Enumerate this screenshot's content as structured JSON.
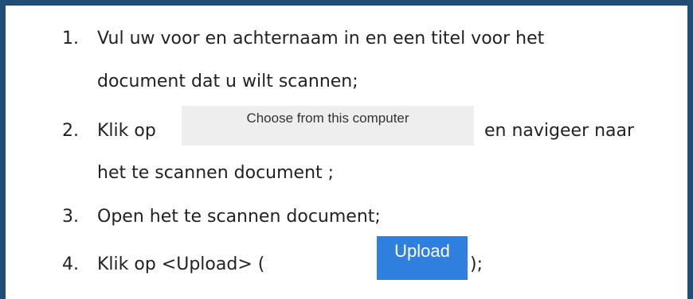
{
  "steps": [
    {
      "number": "1.",
      "line1": "Vul uw voor en achternaam in en een titel voor het",
      "line2": "document dat u wilt scannen;"
    },
    {
      "number": "2.",
      "before": "Klik op",
      "button_label": "Choose from this computer",
      "after": "en navigeer naar",
      "line2": "het te scannen document ;"
    },
    {
      "number": "3.",
      "line1": "Open het te scannen document;"
    },
    {
      "number": "4.",
      "before": "Klik op <Upload> (",
      "button_label": "Upload",
      "after": ");"
    }
  ],
  "colors": {
    "border": "#1f4e79",
    "upload_button": "#2e7fde",
    "choose_button": "#eeeeee"
  }
}
